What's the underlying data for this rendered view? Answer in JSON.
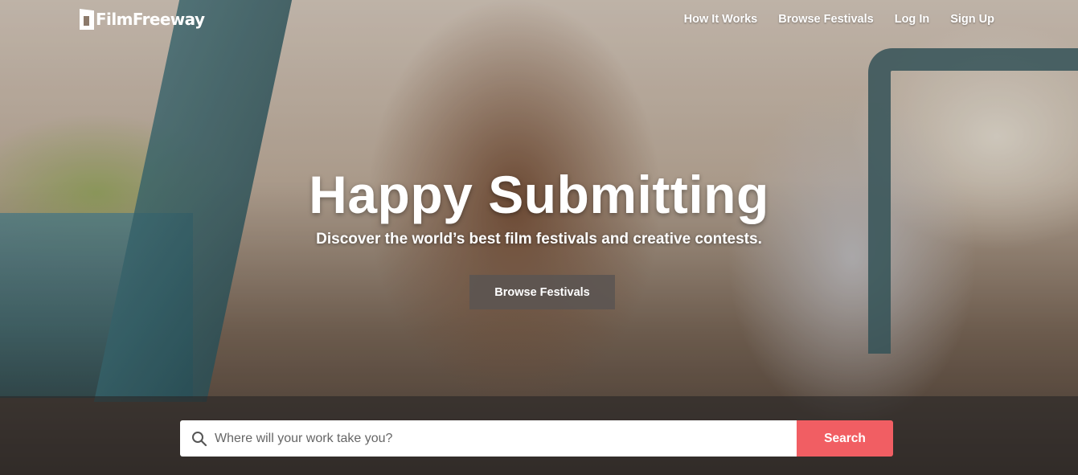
{
  "brand": {
    "name": "FilmFreeway",
    "icon": "filmfreeway-logo-icon"
  },
  "nav": {
    "items": [
      {
        "label": "How It Works"
      },
      {
        "label": "Browse Festivals"
      },
      {
        "label": "Log In"
      },
      {
        "label": "Sign Up"
      }
    ]
  },
  "hero": {
    "title": "Happy Submitting",
    "subtitle": "Discover the world’s best film festivals and creative contests.",
    "cta_label": "Browse Festivals",
    "background_image": "photo of a smiling woman holding a vintage film camera in a truck with a man"
  },
  "search": {
    "placeholder": "Where will your work take you?",
    "value": "",
    "button_label": "Search",
    "icon": "search-icon"
  },
  "colors": {
    "accent": "#f15e63",
    "cta_bg": "#5a5552",
    "text": "#ffffff"
  }
}
